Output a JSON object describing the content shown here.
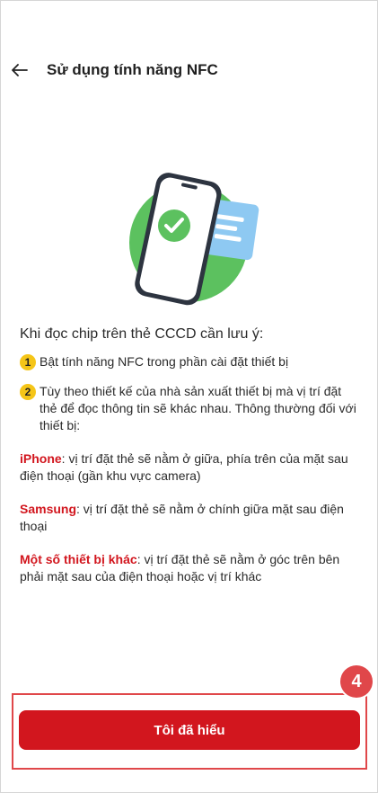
{
  "header": {
    "back_icon": "arrow-left-icon",
    "title": "Sử dụng tính năng NFC"
  },
  "illustration": {
    "icon": "phone-nfc-card-illustration",
    "check_icon": "check-circle-icon",
    "card_icon": "id-card-icon"
  },
  "content": {
    "heading": "Khi đọc chip trên thẻ CCCD cần lưu ý:",
    "steps": [
      {
        "num": "1",
        "text": "Bật tính năng NFC trong phần cài đặt thiết bị"
      },
      {
        "num": "2",
        "text": "Tùy theo thiết kế của nhà sản xuất thiết bị mà vị trí đặt thẻ để đọc thông tin sẽ khác nhau. Thông thường đối với thiết bị:"
      }
    ],
    "devices": [
      {
        "name": "iPhone",
        "text": ": vị trí đặt thẻ sẽ nằm ở giữa, phía trên của mặt sau điện thoại (gần khu vực camera)"
      },
      {
        "name": "Samsung",
        "text": ": vị trí đặt thẻ sẽ nằm ở chính giữa mặt sau điện thoại"
      },
      {
        "name": "Một số thiết bị khác",
        "text": ": vị trí đặt thẻ sẽ nằm ở góc trên bên phải mặt sau của điện thoại hoặc vị trí khác"
      }
    ]
  },
  "annotation": {
    "step_badge": "4"
  },
  "footer": {
    "confirm_label": "Tôi đã hiểu"
  },
  "colors": {
    "accent": "#d2161e",
    "highlight_box": "#e0474a",
    "step_badge": "#f5c518",
    "illustration_green": "#5cc15f",
    "illustration_blue": "#8ec9f2"
  }
}
